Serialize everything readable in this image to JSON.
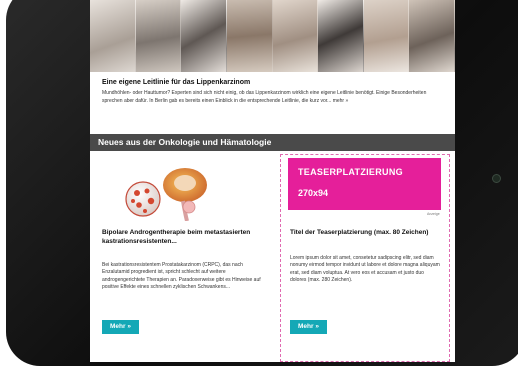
{
  "article": {
    "title": "Eine eigene Leitlinie für das Lippenkarzinom",
    "body": "Mundhöhlen- oder Hauttumor? Experten sind sich nicht einig, ob das Lippenkarzinom wirklich eine eigene Leitlinie benötigt. Einige Besonderheiten sprechen aber dafür. In Berlin gab es bereits einen Einblick in die entsprechende Leitlinie, die kurz vor...",
    "more_label": "mehr »"
  },
  "section": {
    "title": "Neues aus der Onkologie und Hämatologie"
  },
  "left_card": {
    "title": "Bipolare Androgentherapie beim metastasierten kastrationsresistenten...",
    "body": "Bei kastrationsresistentem Prostatakarzinom (CRPC), das nach Enzalutamid progredient ist, spricht schlecht auf weitere androgengerichtete Therapien an. Paradoxerweise gibt es Hinweise auf positive Effekte eines schnellen zyklischen Schwankens...",
    "button_label": "Mehr »"
  },
  "teaser": {
    "line1": "TEASERPLATZIERUNG",
    "line2": "270x94",
    "ad_label": "Anzeige",
    "title": "Titel der Teaserplatzierung (max. 80 Zeichen)",
    "body": "Lorem ipsum dolor sit amet, consetetur sadipscing elitr, sed diam nonumy eirmod tempor invidunt ut labore et dolore magna aliquyam erat, sed diam voluptua. At vero eos et accusam et justo duo dolores (max. 280 Zeichen).",
    "button_label": "Mehr »"
  },
  "colors": {
    "accent_teal": "#14a8b6",
    "teaser_pink": "#e51f9a",
    "section_bar": "#4a4a4a"
  }
}
